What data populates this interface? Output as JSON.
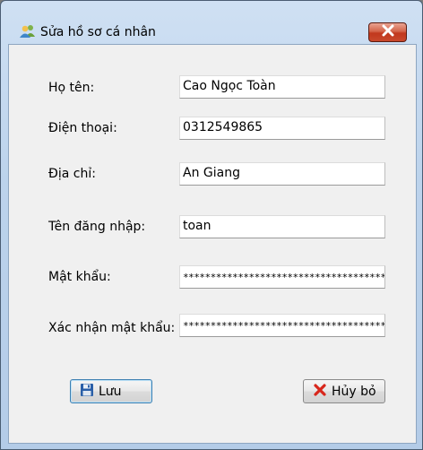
{
  "window": {
    "title": "Sửa hồ sơ cá nhân",
    "app_icon": "users-icon",
    "close_icon": "close-icon"
  },
  "form": {
    "fields": [
      {
        "label": "Họ tên:",
        "value": "Cao Ngọc Toàn"
      },
      {
        "label": "Điện thoại:",
        "value": "0312549865"
      },
      {
        "label": "Địa chỉ:",
        "value": "An Giang"
      },
      {
        "label": "Tên đăng nhập:",
        "value": "toan"
      },
      {
        "label": "Mật khẩu:",
        "value": "*******************************************"
      },
      {
        "label": "Xác nhận mật khẩu:",
        "value": "*******************************************"
      }
    ]
  },
  "buttons": {
    "save_label": "Lưu",
    "save_icon": "floppy-disk-icon",
    "cancel_label": "Hủy bỏ",
    "cancel_icon": "red-x-icon"
  }
}
